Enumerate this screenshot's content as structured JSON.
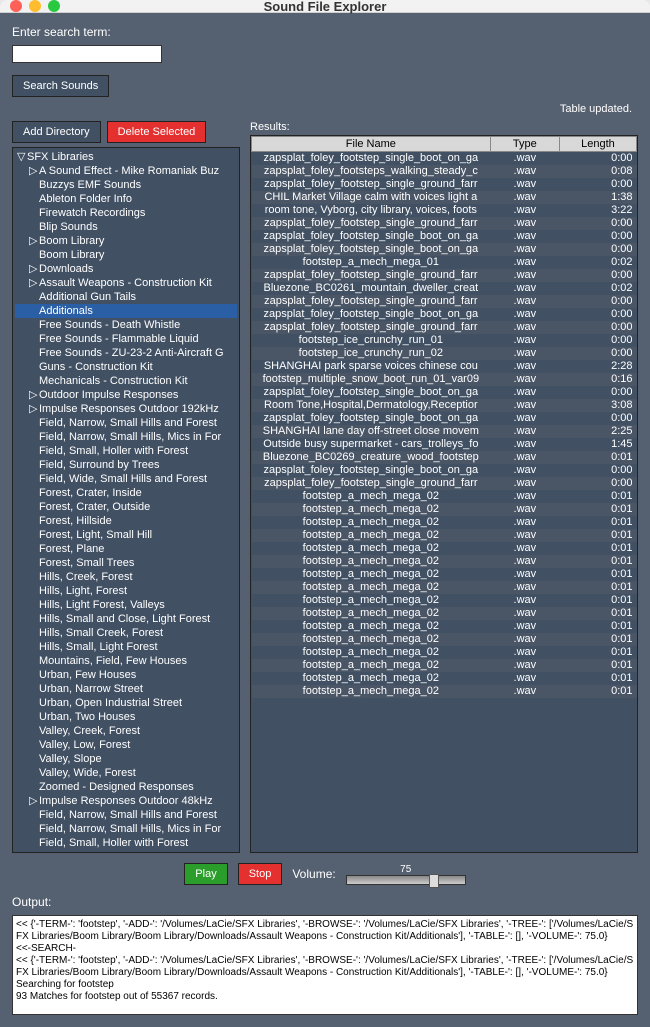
{
  "window": {
    "title": "Sound File Explorer"
  },
  "search": {
    "label": "Enter search term:",
    "value": "",
    "button": "Search Sounds"
  },
  "status": "Table updated.",
  "buttons": {
    "add_dir": "Add Directory",
    "delete_sel": "Delete Selected",
    "play": "Play",
    "stop": "Stop"
  },
  "results_label": "Results:",
  "volume_label": "Volume:",
  "volume_value": "75",
  "output_label": "Output:",
  "tree": {
    "root": "SFX Libraries",
    "children": [
      {
        "label": "A Sound Effect - Mike Romaniak Buz",
        "arrow": true
      },
      {
        "label": "Buzzys EMF Sounds"
      },
      {
        "label": "Ableton Folder Info"
      },
      {
        "label": "Firewatch Recordings"
      },
      {
        "label": "Blip Sounds"
      },
      {
        "label": "Boom Library",
        "arrow": true
      },
      {
        "label": "Boom Library"
      },
      {
        "label": "Downloads",
        "arrow": true
      },
      {
        "label": "Assault Weapons - Construction Kit",
        "arrow": true
      },
      {
        "label": "Additional Gun Tails"
      },
      {
        "label": "Additionals",
        "selected": true
      },
      {
        "label": "Free Sounds - Death Whistle"
      },
      {
        "label": "Free Sounds - Flammable Liquid"
      },
      {
        "label": "Free Sounds - ZU-23-2 Anti-Aircraft G"
      },
      {
        "label": "Guns - Construction Kit"
      },
      {
        "label": "Mechanicals - Construction Kit"
      },
      {
        "label": "Outdoor Impulse Responses",
        "arrow": true
      },
      {
        "label": "Impulse Responses Outdoor 192kHz",
        "arrow": true
      },
      {
        "label": "Field, Narrow, Small Hills and Forest"
      },
      {
        "label": "Field, Narrow, Small Hills, Mics in For"
      },
      {
        "label": "Field, Small, Holler with Forest"
      },
      {
        "label": "Field, Surround by Trees"
      },
      {
        "label": "Field, Wide, Small Hills and Forest"
      },
      {
        "label": "Forest, Crater, Inside"
      },
      {
        "label": "Forest, Crater, Outside"
      },
      {
        "label": "Forest, Hillside"
      },
      {
        "label": "Forest, Light, Small Hill"
      },
      {
        "label": "Forest, Plane"
      },
      {
        "label": "Forest, Small Trees"
      },
      {
        "label": "Hills, Creek, Forest"
      },
      {
        "label": "Hills, Light, Forest"
      },
      {
        "label": "Hills, Light Forest, Valleys"
      },
      {
        "label": "Hills, Small and Close, Light Forest"
      },
      {
        "label": "Hills, Small Creek, Forest"
      },
      {
        "label": "Hills, Small, Light Forest"
      },
      {
        "label": "Mountains, Field, Few Houses"
      },
      {
        "label": "Urban, Few Houses"
      },
      {
        "label": "Urban, Narrow Street"
      },
      {
        "label": "Urban, Open Industrial Street"
      },
      {
        "label": "Urban, Two Houses"
      },
      {
        "label": "Valley, Creek, Forest"
      },
      {
        "label": "Valley, Low, Forest"
      },
      {
        "label": "Valley, Slope"
      },
      {
        "label": "Valley, Wide, Forest"
      },
      {
        "label": "Zoomed - Designed Responses"
      },
      {
        "label": "Impulse Responses Outdoor 48kHz",
        "arrow": true
      },
      {
        "label": "Field, Narrow, Small Hills and Forest"
      },
      {
        "label": "Field, Narrow, Small Hills, Mics in For"
      },
      {
        "label": "Field, Small, Holler with Forest"
      }
    ]
  },
  "table": {
    "columns": [
      "File Name",
      "Type",
      "Length"
    ],
    "rows": [
      [
        "zapsplat_foley_footstep_single_boot_on_ga",
        ".wav",
        "0:00"
      ],
      [
        "zapsplat_foley_footsteps_walking_steady_c",
        ".wav",
        "0:08"
      ],
      [
        "zapsplat_foley_footstep_single_ground_farr",
        ".wav",
        "0:00"
      ],
      [
        "CHIL Market Village calm with voices light a",
        ".wav",
        "1:38"
      ],
      [
        "room tone, Vyborg, city library, voices, foots",
        ".wav",
        "3:22"
      ],
      [
        "zapsplat_foley_footstep_single_ground_farr",
        ".wav",
        "0:00"
      ],
      [
        "zapsplat_foley_footstep_single_boot_on_ga",
        ".wav",
        "0:00"
      ],
      [
        "zapsplat_foley_footstep_single_boot_on_ga",
        ".wav",
        "0:00"
      ],
      [
        "footstep_a_mech_mega_01",
        ".wav",
        "0:02"
      ],
      [
        "zapsplat_foley_footstep_single_ground_farr",
        ".wav",
        "0:00"
      ],
      [
        "Bluezone_BC0261_mountain_dweller_creat",
        ".wav",
        "0:02"
      ],
      [
        "zapsplat_foley_footstep_single_ground_farr",
        ".wav",
        "0:00"
      ],
      [
        "zapsplat_foley_footstep_single_boot_on_ga",
        ".wav",
        "0:00"
      ],
      [
        "zapsplat_foley_footstep_single_ground_farr",
        ".wav",
        "0:00"
      ],
      [
        "footstep_ice_crunchy_run_01",
        ".wav",
        "0:00"
      ],
      [
        "footstep_ice_crunchy_run_02",
        ".wav",
        "0:00"
      ],
      [
        "SHANGHAI park sparse voices chinese cou",
        ".wav",
        "2:28"
      ],
      [
        "footstep_multiple_snow_boot_run_01_var09",
        ".wav",
        "0:16"
      ],
      [
        "zapsplat_foley_footstep_single_boot_on_ga",
        ".wav",
        "0:00"
      ],
      [
        "Room Tone,Hospital,Dermatology,Receptior",
        ".wav",
        "3:08"
      ],
      [
        "zapsplat_foley_footstep_single_boot_on_ga",
        ".wav",
        "0:00"
      ],
      [
        "SHANGHAI lane day off-street close movem",
        ".wav",
        "2:25"
      ],
      [
        "Outside busy supermarket - cars_trolleys_fo",
        ".wav",
        "1:45"
      ],
      [
        "Bluezone_BC0269_creature_wood_footstep",
        ".wav",
        "0:01"
      ],
      [
        "zapsplat_foley_footstep_single_boot_on_ga",
        ".wav",
        "0:00"
      ],
      [
        "zapsplat_foley_footstep_single_ground_farr",
        ".wav",
        "0:00"
      ],
      [
        "footstep_a_mech_mega_02",
        ".wav",
        "0:01"
      ],
      [
        "footstep_a_mech_mega_02",
        ".wav",
        "0:01"
      ],
      [
        "footstep_a_mech_mega_02",
        ".wav",
        "0:01"
      ],
      [
        "footstep_a_mech_mega_02",
        ".wav",
        "0:01"
      ],
      [
        "footstep_a_mech_mega_02",
        ".wav",
        "0:01"
      ],
      [
        "footstep_a_mech_mega_02",
        ".wav",
        "0:01"
      ],
      [
        "footstep_a_mech_mega_02",
        ".wav",
        "0:01"
      ],
      [
        "footstep_a_mech_mega_02",
        ".wav",
        "0:01"
      ],
      [
        "footstep_a_mech_mega_02",
        ".wav",
        "0:01"
      ],
      [
        "footstep_a_mech_mega_02",
        ".wav",
        "0:01"
      ],
      [
        "footstep_a_mech_mega_02",
        ".wav",
        "0:01"
      ],
      [
        "footstep_a_mech_mega_02",
        ".wav",
        "0:01"
      ],
      [
        "footstep_a_mech_mega_02",
        ".wav",
        "0:01"
      ],
      [
        "footstep_a_mech_mega_02",
        ".wav",
        "0:01"
      ],
      [
        "footstep_a_mech_mega_02",
        ".wav",
        "0:01"
      ],
      [
        "footstep_a_mech_mega_02",
        ".wav",
        "0:01"
      ]
    ]
  },
  "output_text": "<< {'-TERM-': 'footstep', '-ADD-': '/Volumes/LaCie/SFX Libraries', '-BROWSE-': '/Volumes/LaCie/SFX Libraries', '-TREE-': ['/Volumes/LaCie/SFX Libraries/Boom Library/Boom Library/Downloads/Assault Weapons - Construction Kit/Additionals'], '-TABLE-': [], '-VOLUME-': 75.0}\n<<-SEARCH-\n<< {'-TERM-': 'footstep', '-ADD-': '/Volumes/LaCie/SFX Libraries', '-BROWSE-': '/Volumes/LaCie/SFX Libraries', '-TREE-': ['/Volumes/LaCie/SFX Libraries/Boom Library/Boom Library/Downloads/Assault Weapons - Construction Kit/Additionals'], '-TABLE-': [], '-VOLUME-': 75.0}\nSearching for footstep\n93 Matches for footstep out of 55367 records."
}
